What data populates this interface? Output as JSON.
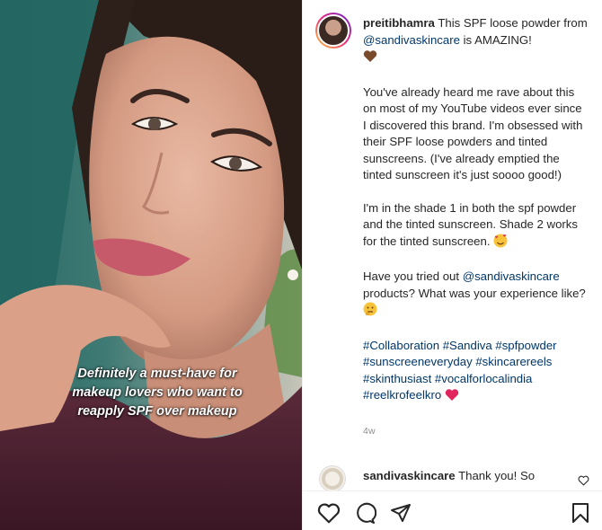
{
  "post": {
    "username": "preitibhamra",
    "lead_text": " This SPF loose powder from ",
    "mention1": "@sandivaskincare",
    "lead_tail": " is AMAZING!",
    "para1": "You've already heard me rave about this on most of my YouTube videos ever since I discovered this brand. I'm obsessed with their SPF loose powders and tinted sunscreens. (I've already emptied the tinted sunscreen it's just soooo good!)",
    "para2": "I'm in the shade 1 in both the spf powder and the tinted sunscreen. Shade 2 works for the tinted sunscreen.",
    "para3_a": "Have you tried out ",
    "mention2": "@sandivaskincare",
    "para3_b": " products? What was your experience like?",
    "hashtags": "#Collaboration #Sandiva #spfpowder #sunscreeneveryday #skincarereels #skinthusiast #vocalforlocalindia #reelkrofeelkro",
    "timestamp": "4w"
  },
  "media": {
    "overlay_line1": "Definitely a must-have for",
    "overlay_line2": "makeup lovers who want to",
    "overlay_line3": "reapply SPF over makeup"
  },
  "comment": {
    "username": "sandivaskincare",
    "text": " Thank you! So"
  },
  "icons": {
    "like": "heart-outline-icon",
    "comment": "speech-bubble-icon",
    "share": "paper-plane-icon",
    "save": "bookmark-icon"
  }
}
